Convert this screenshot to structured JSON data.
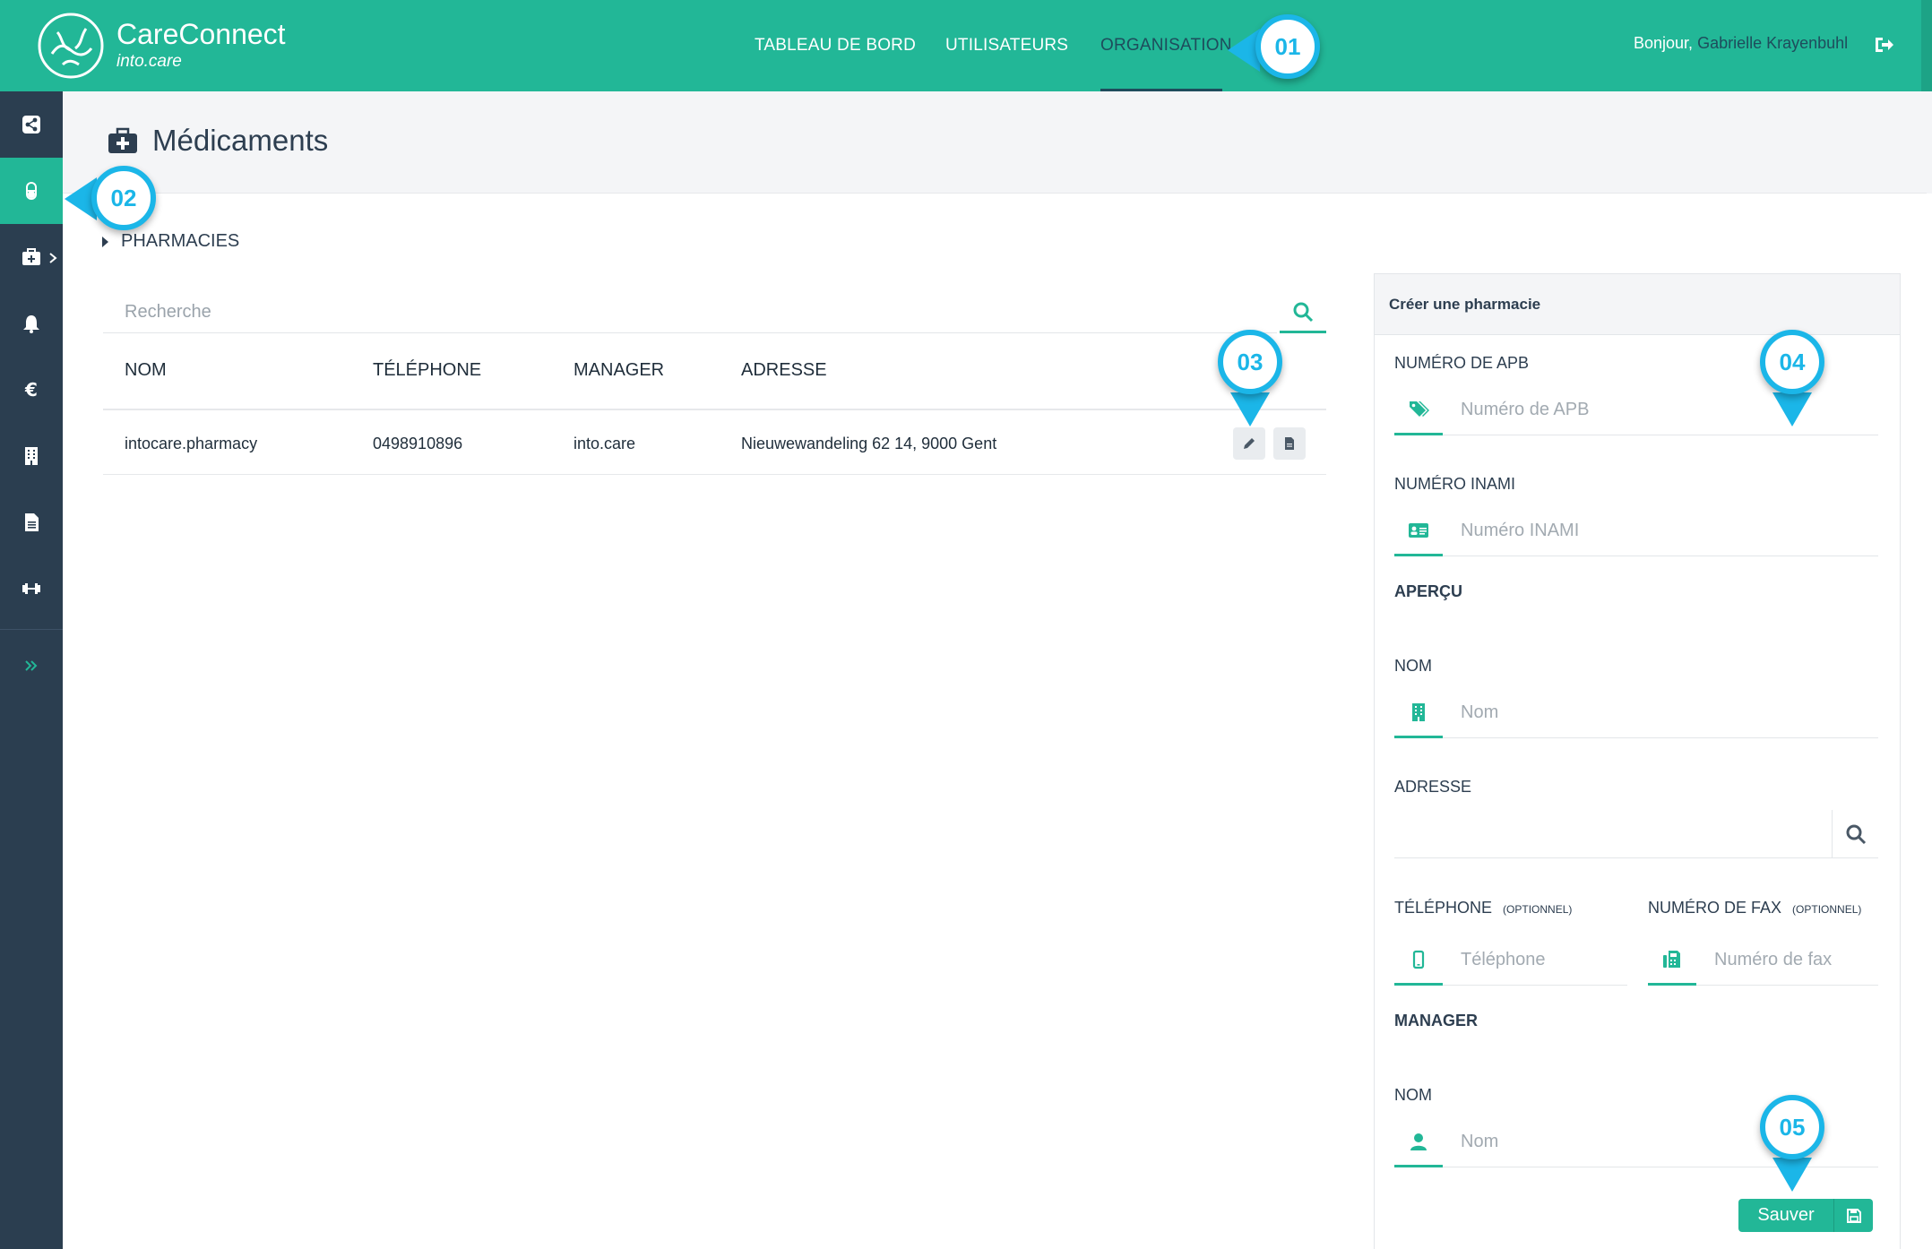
{
  "app": {
    "brand_title": "CareConnect",
    "brand_sub": "into.care",
    "accent_color": "#22b797",
    "sidebar_color": "#2b3e50",
    "callout_color": "#1bb6e8"
  },
  "nav": {
    "items": [
      {
        "label": "TABLEAU DE BORD",
        "active": false
      },
      {
        "label": "UTILISATEURS",
        "active": false
      },
      {
        "label": "ORGANISATION",
        "active": true
      }
    ],
    "greeting_prefix": "Bonjour,",
    "user_name": "Gabrielle Krayenbuhl",
    "logout_icon": "sign-out-icon"
  },
  "sidebar": {
    "items": [
      {
        "icon": "share-icon",
        "active": false
      },
      {
        "icon": "pill-icon",
        "active": true
      },
      {
        "icon": "medkit-icon",
        "active": false
      },
      {
        "icon": "bell-icon",
        "active": false
      },
      {
        "icon": "euro-icon",
        "active": false
      },
      {
        "icon": "building-icon",
        "active": false
      },
      {
        "icon": "document-icon",
        "active": false
      },
      {
        "icon": "dumbbell-icon",
        "active": false
      },
      {
        "icon": "double-chevron-right-icon",
        "active": false
      }
    ]
  },
  "page": {
    "title": "Médicaments",
    "section_toggle": "PHARMACIES"
  },
  "search": {
    "placeholder": "Recherche"
  },
  "table": {
    "columns": [
      "NOM",
      "TÉLÉPHONE",
      "MANAGER",
      "ADRESSE"
    ],
    "rows": [
      {
        "nom": "intocare.pharmacy",
        "telephone": "0498910896",
        "manager": "into.care",
        "adresse": "Nieuwewandeling 62 14, 9000 Gent"
      }
    ],
    "row_actions": [
      "edit-icon",
      "document-icon"
    ]
  },
  "form": {
    "title": "Créer une pharmacie",
    "apb_label": "NUMÉRO DE APB",
    "apb_placeholder": "Numéro de APB",
    "inami_label": "NUMÉRO INAMI",
    "inami_placeholder": "Numéro INAMI",
    "apercu_label": "APERÇU",
    "nom_label": "NOM",
    "nom_placeholder": "Nom",
    "adresse_label": "ADRESSE",
    "telephone_label": "TÉLÉPHONE",
    "telephone_optional": "(OPTIONNEL)",
    "telephone_placeholder": "Téléphone",
    "fax_label": "NUMÉRO DE FAX",
    "fax_optional": "(OPTIONNEL)",
    "fax_placeholder": "Numéro de fax",
    "manager_label": "MANAGER",
    "manager_nom_label": "NOM",
    "manager_nom_placeholder": "Nom",
    "save_label": "Sauver"
  },
  "callouts": [
    "01",
    "02",
    "03",
    "04",
    "05"
  ]
}
